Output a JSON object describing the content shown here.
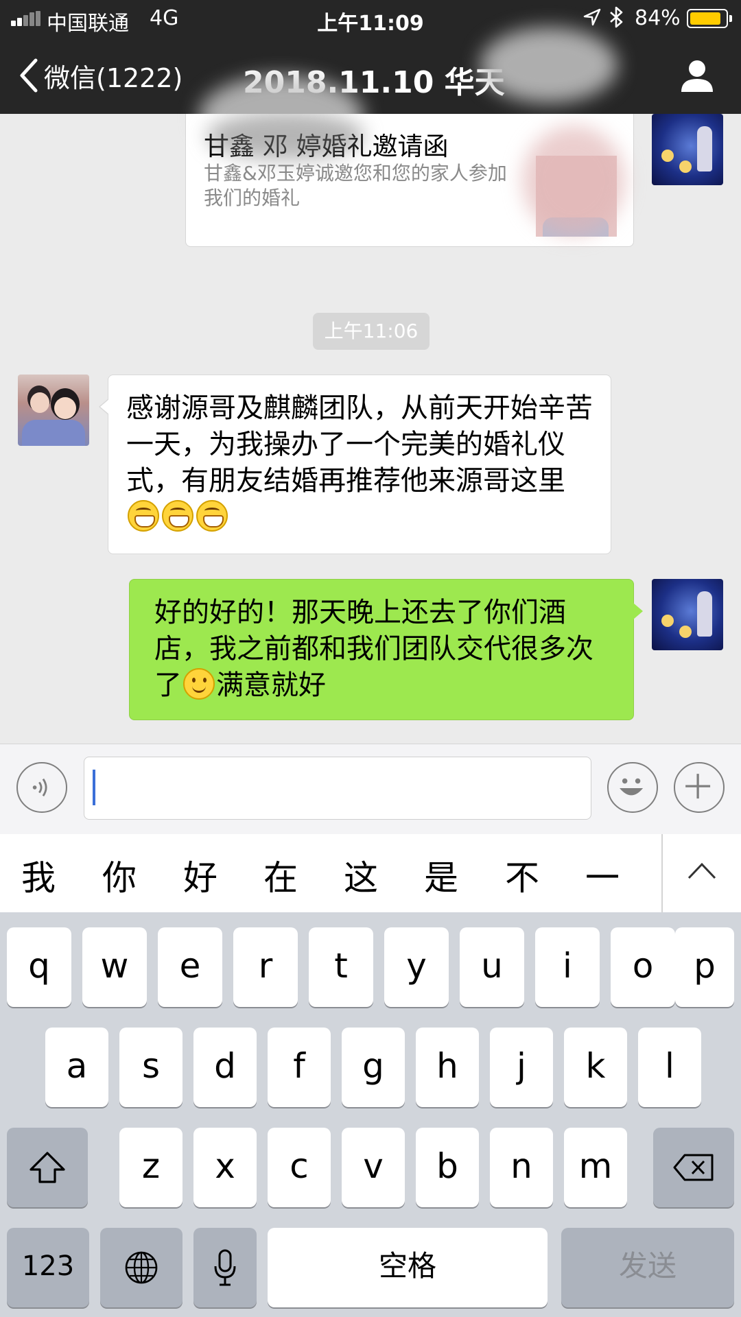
{
  "status_bar": {
    "carrier": "中国联通",
    "network": "4G",
    "time": "上午11:09",
    "battery": "84%",
    "battery_level": 0.84,
    "signal_bars_filled": 2,
    "icons": [
      "signal-icon",
      "location-icon",
      "bluetooth-icon",
      "battery-icon"
    ]
  },
  "nav": {
    "back_label": "微信(1222)",
    "title": "2018.11.10 华天",
    "icons": [
      "back-chevron-icon",
      "profile-icon"
    ]
  },
  "chat": {
    "card": {
      "title": "甘鑫  邓   婷婚礼邀请函",
      "description": "甘鑫&邓玉婷诚邀您和您的家人参加我们的婚礼"
    },
    "timestamp": "上午11:06",
    "messages": [
      {
        "side": "left",
        "text": "感谢源哥及麒麟团队，从前天开始辛苦一天，为我操办了一个完美的婚礼仪式，有朋友结婚再推荐他来源哥这里",
        "emojis": [
          "grin-emoji",
          "grin-emoji",
          "grin-emoji"
        ]
      },
      {
        "side": "right",
        "text_before_emoji": "好的好的！那天晚上还去了你们酒店，我之前都和我们团队交代很多次了",
        "text_after_emoji": "满意就好",
        "emojis": [
          "smile-emoji"
        ]
      }
    ]
  },
  "input_bar": {
    "value": "",
    "icons": [
      "voice-icon",
      "emoji-icon",
      "plus-icon"
    ]
  },
  "candidates": [
    "我",
    "你",
    "好",
    "在",
    "这",
    "是",
    "不",
    "一"
  ],
  "keyboard": {
    "row1": [
      "q",
      "w",
      "e",
      "r",
      "t",
      "y",
      "u",
      "i",
      "o",
      "p"
    ],
    "row2": [
      "a",
      "s",
      "d",
      "f",
      "g",
      "h",
      "j",
      "k",
      "l"
    ],
    "row3": [
      "z",
      "x",
      "c",
      "v",
      "b",
      "n",
      "m"
    ],
    "numbers_label": "123",
    "space_label": "空格",
    "send_label": "发送",
    "icons": [
      "shift-icon",
      "backspace-icon",
      "globe-icon",
      "microphone-icon",
      "collapse-chevron-icon"
    ]
  },
  "colors": {
    "header_bg": "#262626",
    "chat_bg": "#ebebeb",
    "sent_bubble": "#9de84f",
    "received_bubble": "#ffffff",
    "keyboard_bg": "#d1d5db",
    "battery_fill": "#ffcc00"
  }
}
